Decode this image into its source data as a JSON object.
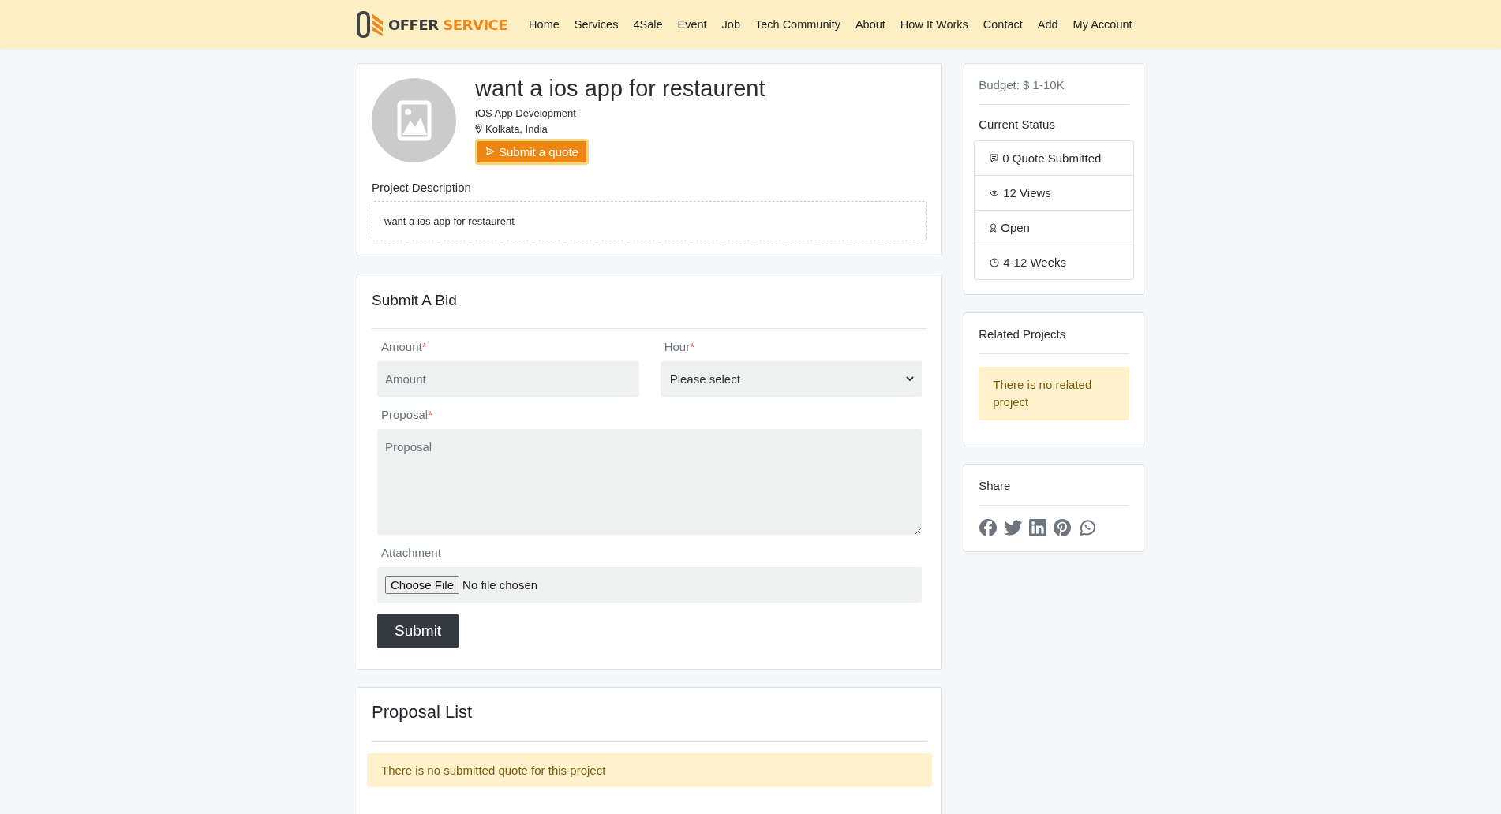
{
  "header": {
    "brand": {
      "first": "OFFER",
      "second": "SERVICE"
    },
    "nav": [
      {
        "label": "Home"
      },
      {
        "label": "Services"
      },
      {
        "label": "4Sale"
      },
      {
        "label": "Event"
      },
      {
        "label": "Job"
      },
      {
        "label": "Tech Community"
      },
      {
        "label": "About"
      },
      {
        "label": "How It Works"
      },
      {
        "label": "Contact"
      },
      {
        "label": "Add"
      },
      {
        "label": "My Account"
      }
    ]
  },
  "project": {
    "title": "want a ios app for restaurent",
    "category": "iOS App Development",
    "location": "Kolkata, India",
    "quote_button": "Submit a quote",
    "description_heading": "Project Description",
    "description": "want a ios app for restaurent"
  },
  "bid_form": {
    "title": "Submit A Bid",
    "amount": {
      "label": "Amount",
      "required_mark": "*",
      "placeholder": "Amount"
    },
    "hour": {
      "label": "Hour",
      "required_mark": "*",
      "value": "Please select"
    },
    "proposal": {
      "label": "Proposal",
      "required_mark": "*",
      "placeholder": "Proposal"
    },
    "attachment": {
      "label": "Attachment",
      "button": "Choose File",
      "status": "No file chosen"
    },
    "submit": "Submit"
  },
  "proposal_list": {
    "title": "Proposal List",
    "empty_message": "There is no submitted quote for this project"
  },
  "sidebar": {
    "budget": "Budget: $ 1-10K",
    "status_heading": "Current Status",
    "status_items": [
      {
        "kind": "quotes",
        "text": "0 Quote Submitted"
      },
      {
        "kind": "views",
        "text": "12 Views"
      },
      {
        "kind": "state",
        "text": "Open"
      },
      {
        "kind": "duration",
        "text": "4-12 Weeks"
      }
    ],
    "related_heading": "Related Projects",
    "related_empty": "There is no related project",
    "share_heading": "Share"
  }
}
